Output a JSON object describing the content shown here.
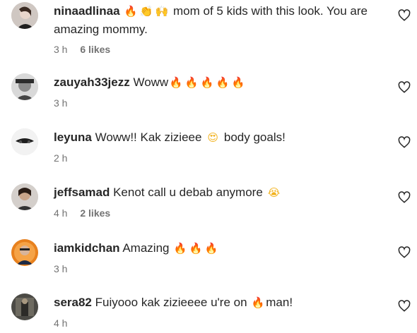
{
  "comments": [
    {
      "username": "ninaadlinaa",
      "text_before": " mom of 5 kids with this look. You are amazing mommy.",
      "emojis": [
        "fire-emoji",
        "clapping-hands-emoji",
        "raising-hands-emoji"
      ],
      "time": "3 h",
      "likes": "6 likes"
    },
    {
      "username": "zauyah33jezz",
      "text_before": " Woww",
      "emojis": [
        "fire-emoji",
        "fire-emoji",
        "fire-emoji",
        "fire-emoji",
        "fire-emoji"
      ],
      "time": "3 h",
      "likes": ""
    },
    {
      "username": "leyuna",
      "text_before": " Woww!! Kak zizieee ",
      "emoji_mid": "heart-eyes-emoji",
      "text_after": " body goals!",
      "time": "2 h",
      "likes": ""
    },
    {
      "username": "jeffsamad",
      "text_before": " Kenot call u debab anymore ",
      "emojis": [
        "loudly-crying-face-emoji"
      ],
      "time": "4 h",
      "likes": "2 likes"
    },
    {
      "username": "iamkidchan",
      "text_before": " Amazing ",
      "emojis": [
        "fire-emoji",
        "fire-emoji",
        "fire-emoji"
      ],
      "time": "3 h",
      "likes": ""
    },
    {
      "username": "sera82",
      "text_before": " Fuiyooo kak zizieeee u're on ",
      "emoji_mid": "fire-emoji",
      "text_after": "man!",
      "time": "4 h",
      "likes": ""
    }
  ],
  "icons": {
    "like": "heart-outline-icon"
  },
  "colors": {
    "text": "#262626",
    "secondary": "#737373",
    "fire": "#ff5a1f"
  }
}
